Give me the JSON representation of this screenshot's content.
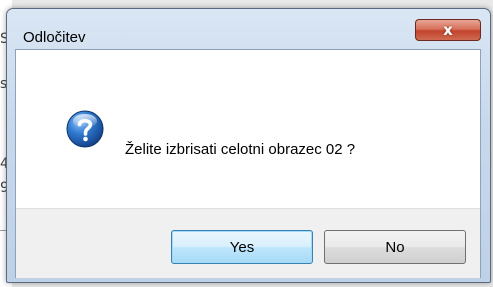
{
  "background": {
    "chars": [
      "S",
      "s",
      "4",
      "9"
    ]
  },
  "dialog": {
    "title": "Odločitev",
    "close_label": "x",
    "message": "Želite izbrisati celotni obrazec 02 ?",
    "icon": "question-icon",
    "buttons": {
      "yes_label": "Yes",
      "no_label": "No"
    }
  },
  "colors": {
    "titlebar": "#c9d9ec",
    "close_button": "#c2442c",
    "icon_blue": "#1f5fb5",
    "default_button_border": "#3c7fb1"
  }
}
